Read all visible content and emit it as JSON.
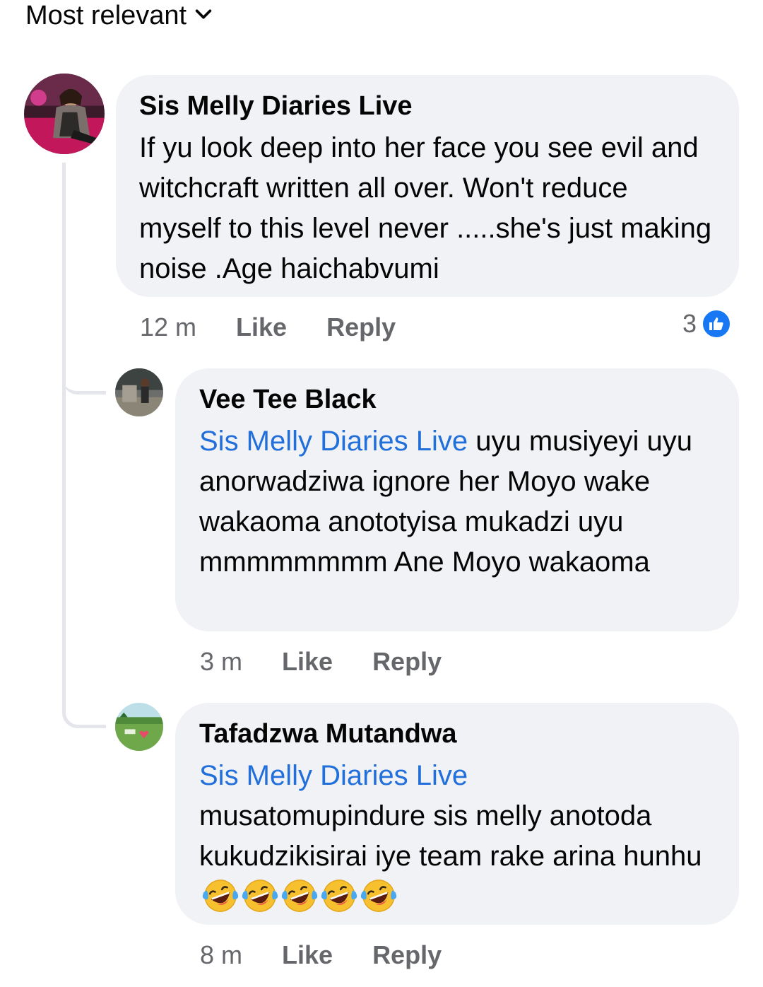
{
  "sort": {
    "label": "Most relevant"
  },
  "comments": [
    {
      "author": "Sis Melly Diaries Live",
      "text": "If yu look deep into her face you see evil and witchcraft written all over. Won't reduce myself to this level never .....she's just making noise .Age haichabvumi",
      "time": "12 m",
      "like_label": "Like",
      "reply_label": "Reply",
      "reaction_count": "3"
    },
    {
      "author": "Vee Tee Black",
      "mention": "Sis Melly Diaries Live",
      "text": " uyu musiyeyi uyu anorwadziwa ignore her Moyo wake wakaoma anototyisa mukadzi uyu mmmmmmmm Ane Moyo wakaoma",
      "time": "3 m",
      "like_label": "Like",
      "reply_label": "Reply"
    },
    {
      "author": "Tafadzwa Mutandwa",
      "mention": "Sis Melly Diaries Live",
      "text": "musatomupindure sis melly anotoda kukudzikisirai iye team rake arina hunhu",
      "emoji_count": 5,
      "emoji_name": "rolling-on-floor-laughing",
      "time": "8 m",
      "like_label": "Like",
      "reply_label": "Reply"
    }
  ],
  "colors": {
    "bubble": "#f0f2f5",
    "mention": "#216fdb",
    "meta": "#65676b",
    "like_blue": "#1877f2"
  }
}
